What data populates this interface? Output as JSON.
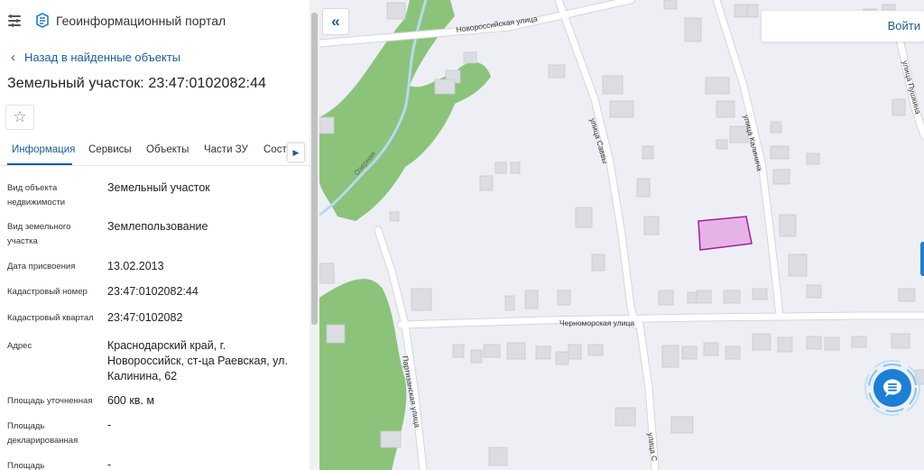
{
  "app": {
    "title": "Геоинформационный портал"
  },
  "nav": {
    "back_label": "Назад в найденные объекты"
  },
  "object": {
    "title": "Земельный участок: 23:47:0102082:44"
  },
  "tabs": [
    {
      "label": "Информация",
      "active": true
    },
    {
      "label": "Сервисы",
      "active": false
    },
    {
      "label": "Объекты",
      "active": false
    },
    {
      "label": "Части ЗУ",
      "active": false
    },
    {
      "label": "Соста",
      "active": false
    }
  ],
  "fields": [
    {
      "label": "Вид объекта недвижимости",
      "value": "Земельный участок"
    },
    {
      "label": "Вид земельного участка",
      "value": "Землепользование"
    },
    {
      "label": "Дата присвоения",
      "value": "13.02.2013"
    },
    {
      "label": "Кадастровый номер",
      "value": "23:47:0102082:44"
    },
    {
      "label": "Кадастровый квартал",
      "value": "23:47:0102082"
    },
    {
      "label": "Адрес",
      "value": "Краснодарский край, г. Новороссийск, ст-ца Раевская, ул. Калинина, 62"
    },
    {
      "label": "Площадь уточненная",
      "value": "600 кв. м"
    },
    {
      "label": "Площадь декларированная",
      "value": "-"
    },
    {
      "label": "Площадь",
      "value": "-"
    }
  ],
  "map": {
    "search_label": "Войти",
    "streets": {
      "novorossiyskaya": "Новороссийская улица",
      "savvy": "улица Саввы",
      "kalinina": "улица Калинина",
      "pushkina": "улица Пушкина",
      "chernomorskaya": "Черноморская улица",
      "partizanskaya": "Партизанская улица",
      "bottom": "улица С"
    },
    "river_label": "Озерная"
  },
  "colors": {
    "accent": "#1c5d9c",
    "map_bg": "#eeeff5",
    "greenery": "#8bc37a",
    "building": "#dcdde3",
    "parcel_fill": "#e7b3e7",
    "parcel_stroke": "#a020a0",
    "chat_button": "#1c7fd6"
  },
  "icons": {
    "menu": "hamburger-icon",
    "logo": "portal-logo-icon",
    "back": "chevron-left-icon",
    "star": "star-outline-icon",
    "tabs_next": "triangle-right-icon",
    "collapse": "double-chevron-left-icon",
    "chat": "chat-bubble-icon"
  }
}
